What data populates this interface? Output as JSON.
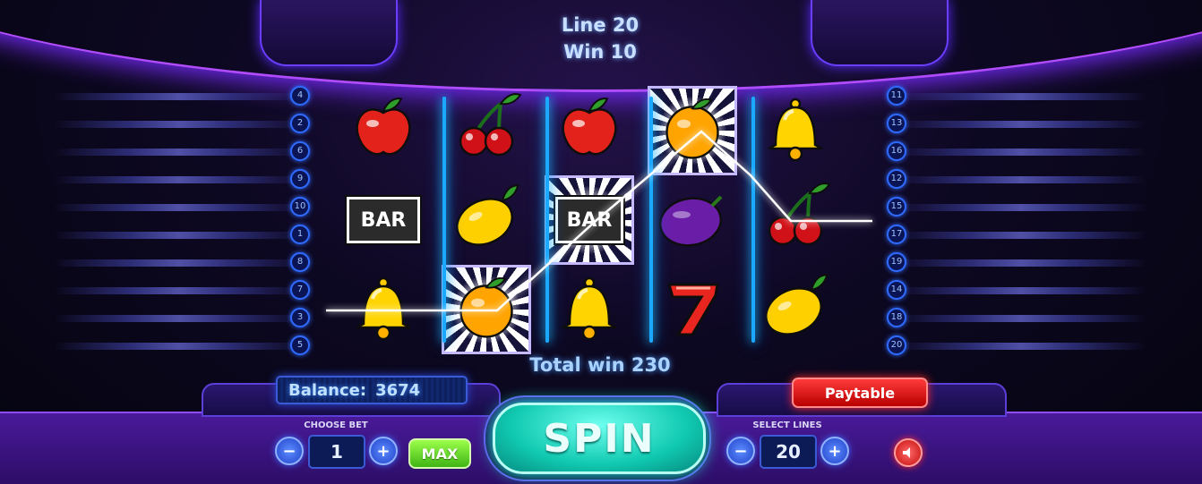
{
  "info": {
    "line_label": "Line 20",
    "win_label": "Win 10"
  },
  "total_win": "Total win 230",
  "balance": {
    "label": "Balance:",
    "value": "3674"
  },
  "paytable_label": "Paytable",
  "bet": {
    "label": "CHOOSE BET",
    "value": "1",
    "minus": "−",
    "plus": "+"
  },
  "max_label": "MAX",
  "spin_label": "SPIN",
  "lines": {
    "label": "SELECT LINES",
    "value": "20",
    "minus": "−",
    "plus": "+"
  },
  "bar_text": "BAR",
  "left_markers": [
    "4",
    "2",
    "6",
    "9",
    "10",
    "1",
    "8",
    "7",
    "3",
    "5"
  ],
  "right_markers": [
    "11",
    "13",
    "16",
    "12",
    "15",
    "17",
    "19",
    "14",
    "18",
    "20"
  ],
  "reels": [
    [
      "apple",
      "bar",
      "bell"
    ],
    [
      "cherries",
      "lemon",
      "orange"
    ],
    [
      "apple",
      "bar",
      "bell"
    ],
    [
      "orange",
      "plum",
      "seven"
    ],
    [
      "bell",
      "cherries",
      "lemon"
    ]
  ],
  "highlighted": [
    [
      1,
      2
    ],
    [
      2,
      1
    ],
    [
      3,
      0
    ]
  ],
  "colors": {
    "accent": "#1aa9ff",
    "spin": "#10c9b0",
    "paytable": "#e00000",
    "max": "#3fb415"
  }
}
